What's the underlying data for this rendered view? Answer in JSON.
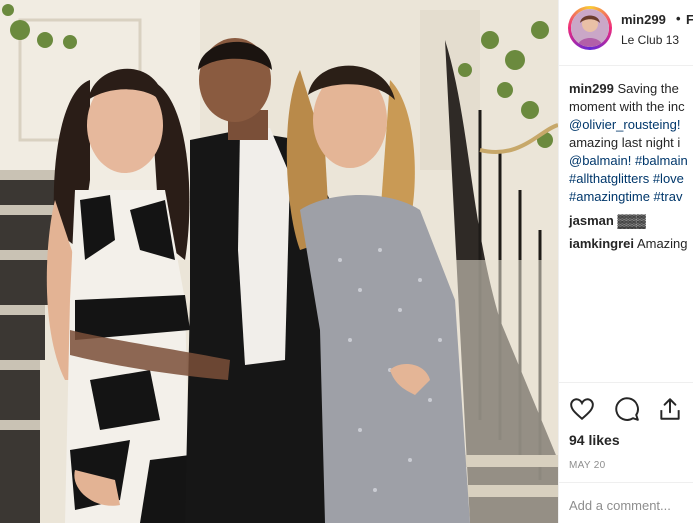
{
  "post": {
    "username": "min299",
    "separator": "•",
    "follow_label": "F",
    "location": "Le Club 13",
    "caption_lines": [
      "Saving the",
      "moment with the inc",
      "@olivier_rousteing!",
      "amazing last night i",
      "@balmain! #balmain",
      "#allthatglitters #love",
      "#amazingtime #trav"
    ],
    "comments": [
      {
        "user": "jasman",
        "text": "▓▓▓"
      },
      {
        "user": "iamkingrei",
        "text": "Amazing"
      }
    ],
    "likes": "94 likes",
    "date": "MAY 20",
    "add_comment_placeholder": "Add a comment..."
  },
  "icons": {
    "like": "heart-icon",
    "comment": "speech-bubble-icon",
    "share": "share-icon"
  },
  "colors": {
    "link": "#00376b",
    "muted": "#8e8e8e",
    "border": "#efefef"
  }
}
